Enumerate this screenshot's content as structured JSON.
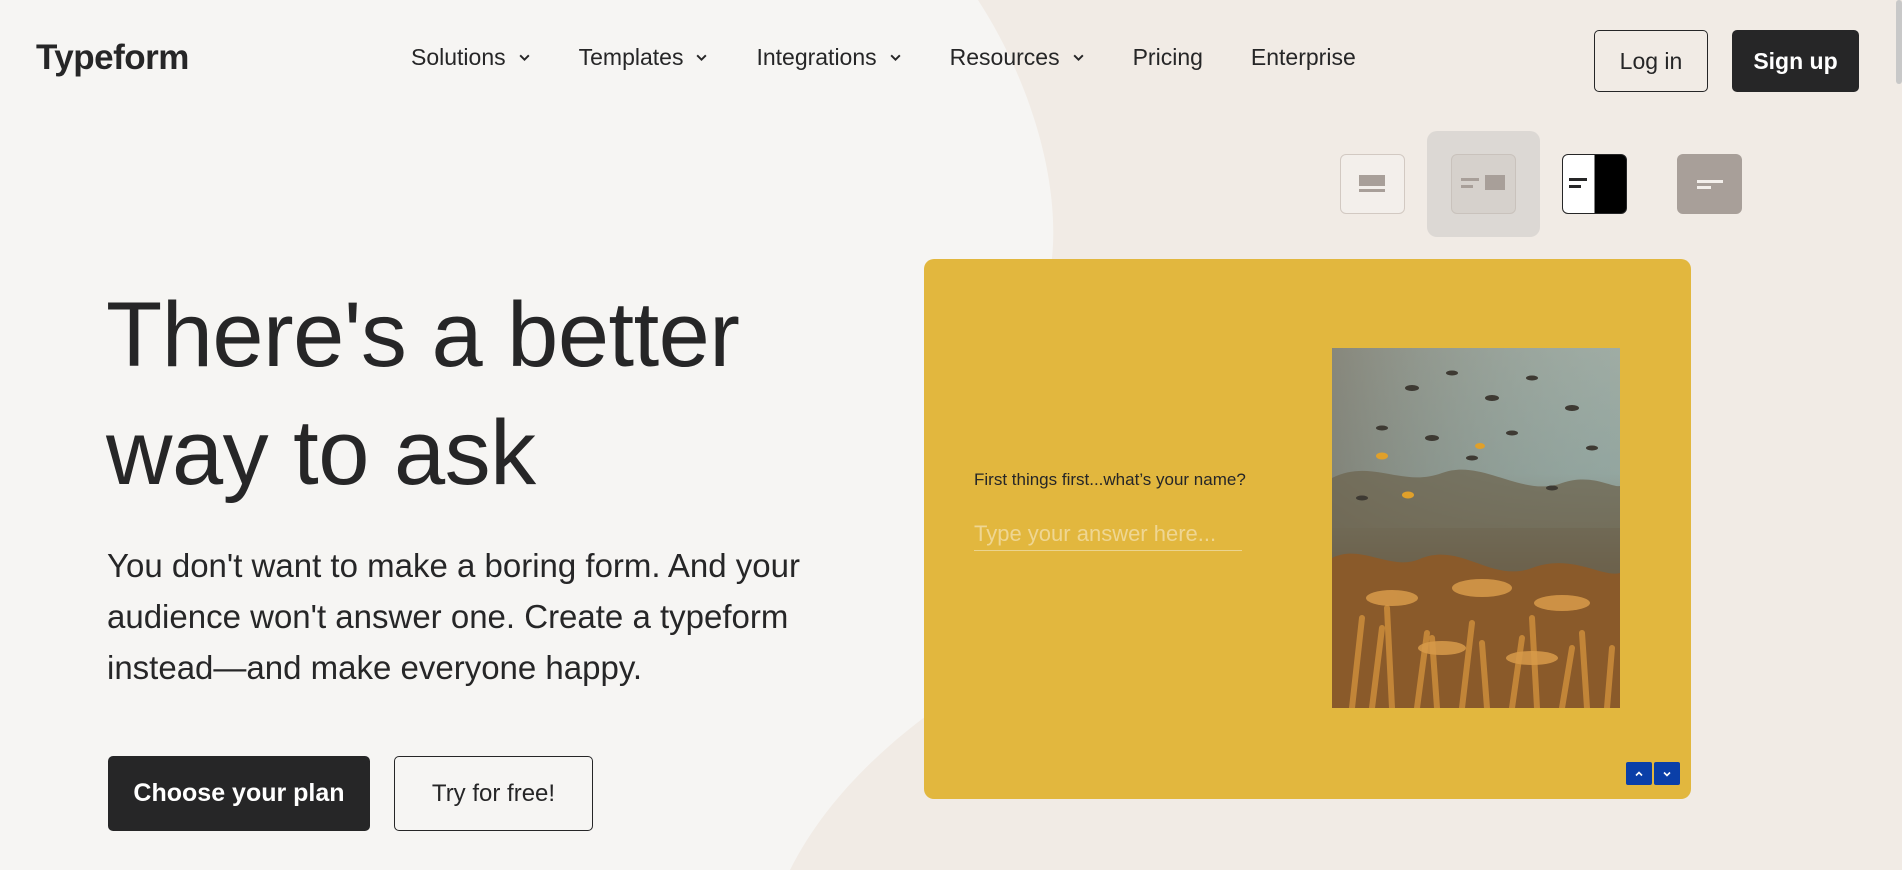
{
  "brand": {
    "logo": "Typeform"
  },
  "nav": {
    "items": [
      {
        "label": "Solutions",
        "dropdown": true
      },
      {
        "label": "Templates",
        "dropdown": true
      },
      {
        "label": "Integrations",
        "dropdown": true
      },
      {
        "label": "Resources",
        "dropdown": true
      },
      {
        "label": "Pricing",
        "dropdown": false
      },
      {
        "label": "Enterprise",
        "dropdown": false
      }
    ],
    "login_label": "Log in",
    "signup_label": "Sign up"
  },
  "hero": {
    "title": "There's a better way to ask",
    "subtitle": "You don't want to make a boring form. And your audience won't answer one. Create a typeform instead—and make everyone happy.",
    "primary_cta": "Choose your plan",
    "secondary_cta": "Try for free!"
  },
  "layout_switcher": {
    "options": [
      "layout-stack-icon",
      "layout-split-icon",
      "layout-half-dark-icon",
      "layout-minimal-icon"
    ],
    "active_index": 1
  },
  "preview": {
    "question": "First things first...what’s your name?",
    "answer_placeholder": "Type your answer here...",
    "background_color": "#e2b73e",
    "nav_color": "#0a3fa8"
  },
  "colors": {
    "text": "#262627",
    "page_bg": "#f6f5f3",
    "accent_bg": "#f1ebe5"
  }
}
